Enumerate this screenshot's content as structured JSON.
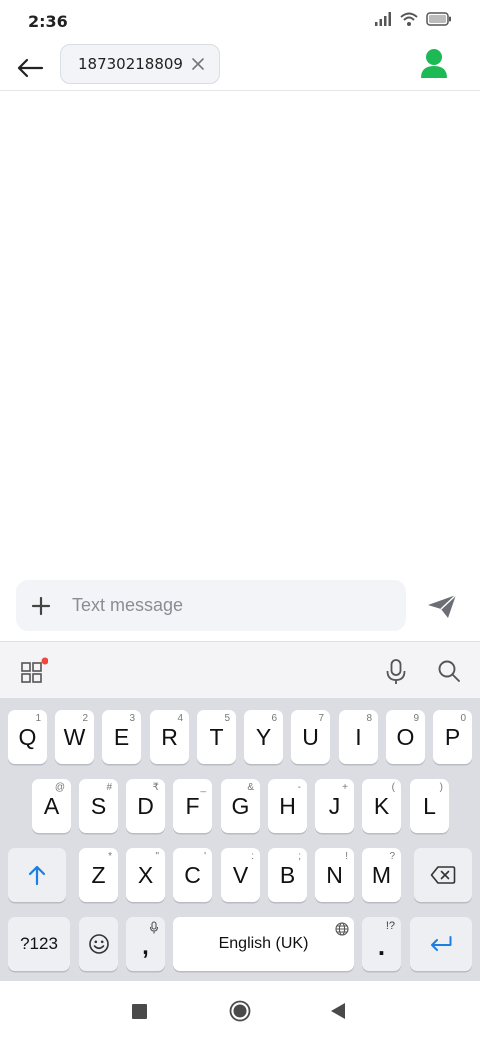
{
  "status_bar": {
    "time": "2:36",
    "icons": [
      "signal-icon",
      "wifi-icon",
      "battery-icon"
    ]
  },
  "header": {
    "recipient": "18730218809"
  },
  "compose": {
    "placeholder": "Text message"
  },
  "keyboard": {
    "row1": [
      {
        "label": "Q",
        "hint": "1"
      },
      {
        "label": "W",
        "hint": "2"
      },
      {
        "label": "E",
        "hint": "3"
      },
      {
        "label": "R",
        "hint": "4"
      },
      {
        "label": "T",
        "hint": "5"
      },
      {
        "label": "Y",
        "hint": "6"
      },
      {
        "label": "U",
        "hint": "7"
      },
      {
        "label": "I",
        "hint": "8"
      },
      {
        "label": "O",
        "hint": "9"
      },
      {
        "label": "P",
        "hint": "0"
      }
    ],
    "row2": [
      {
        "label": "A",
        "hint": "@"
      },
      {
        "label": "S",
        "hint": "#"
      },
      {
        "label": "D",
        "hint": "₹"
      },
      {
        "label": "F",
        "hint": "_"
      },
      {
        "label": "G",
        "hint": "&"
      },
      {
        "label": "H",
        "hint": "-"
      },
      {
        "label": "J",
        "hint": "+"
      },
      {
        "label": "K",
        "hint": "("
      },
      {
        "label": "L",
        "hint": ")"
      }
    ],
    "row3": [
      {
        "label": "Z",
        "hint": "*"
      },
      {
        "label": "X",
        "hint": "\""
      },
      {
        "label": "C",
        "hint": "'"
      },
      {
        "label": "V",
        "hint": ":"
      },
      {
        "label": "B",
        "hint": ";"
      },
      {
        "label": "N",
        "hint": "!"
      },
      {
        "label": "M",
        "hint": "?"
      }
    ],
    "symbols_label": "?123",
    "comma_label": ",",
    "space_label": "English (UK)",
    "period_label": ".",
    "period_hint": "!?"
  },
  "colors": {
    "accent": "#1db954",
    "enter_blue": "#1a7fe0",
    "notification_dot": "#f0483e"
  }
}
